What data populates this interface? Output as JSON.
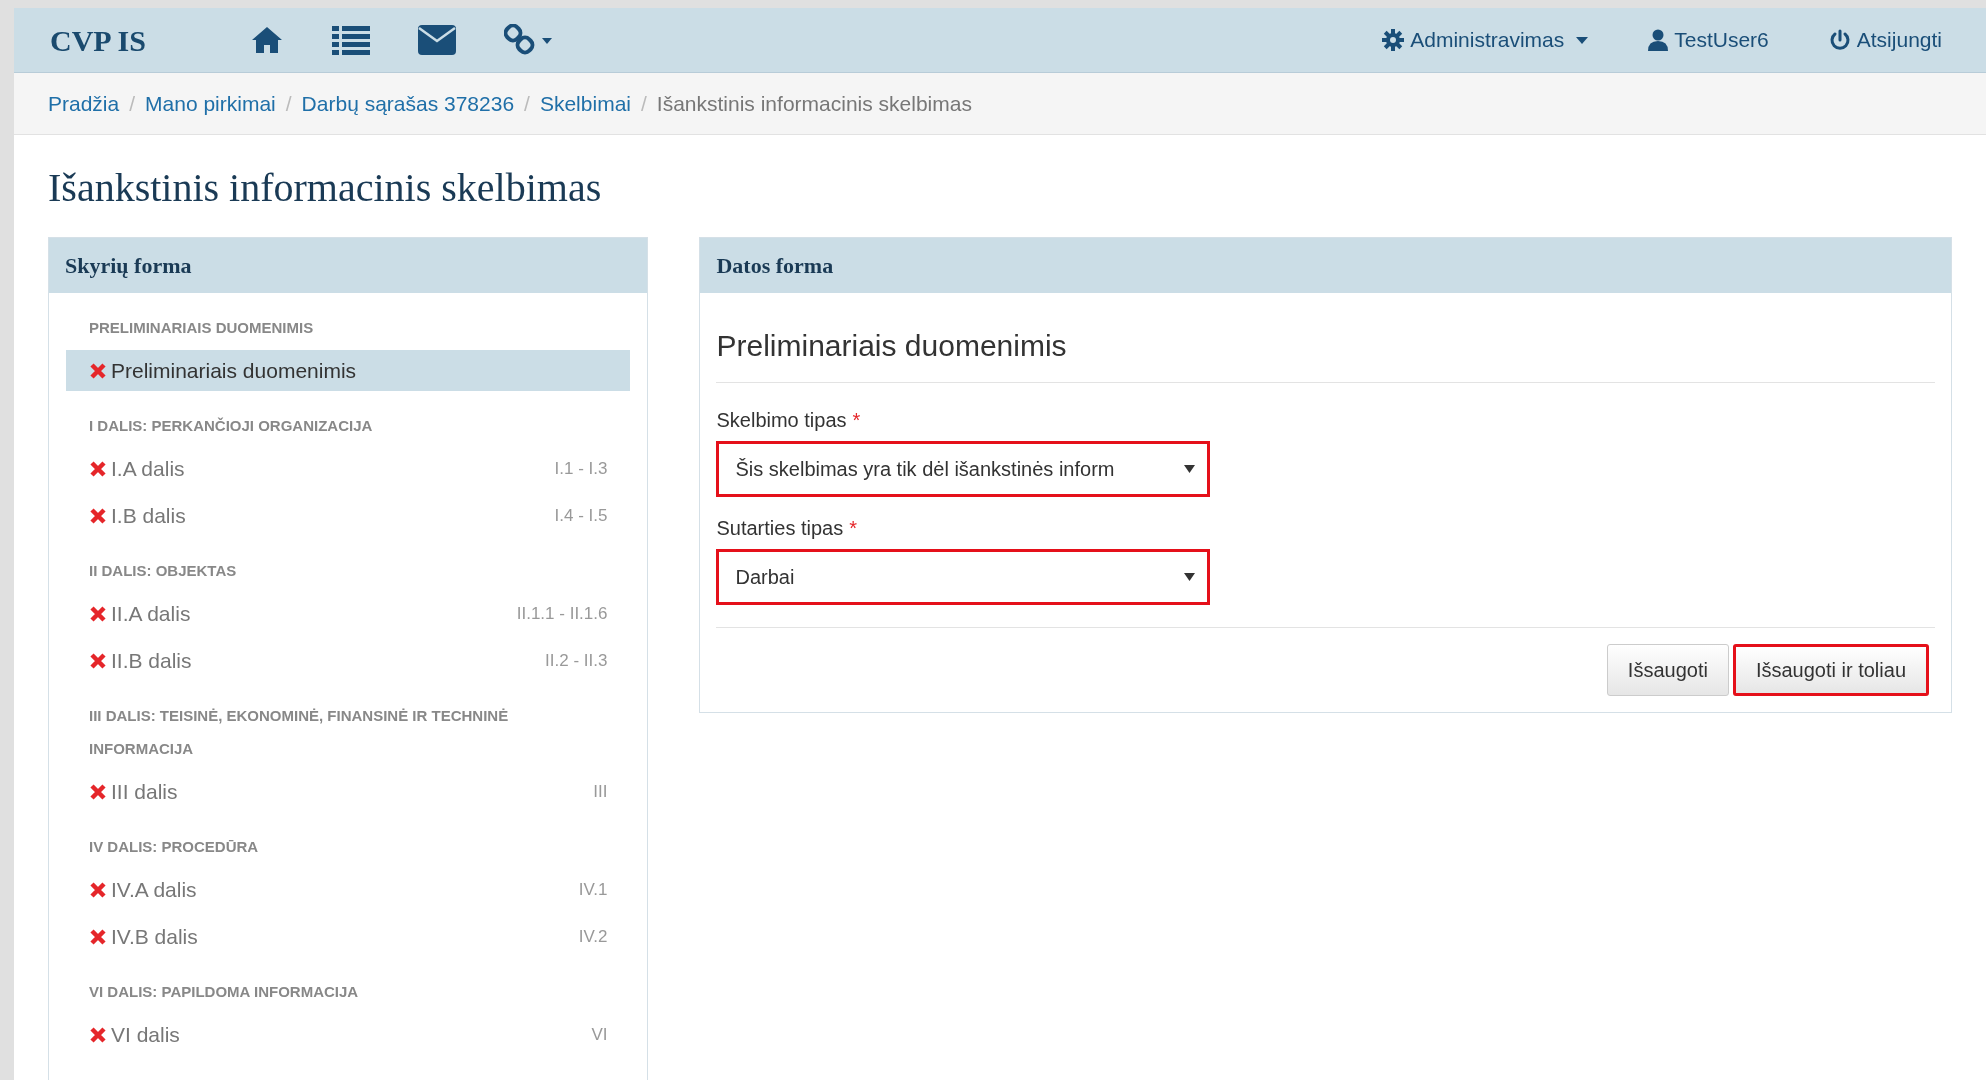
{
  "navbar": {
    "brand": "CVP IS",
    "icons": [
      {
        "kind": "home"
      },
      {
        "kind": "list"
      },
      {
        "kind": "mail"
      },
      {
        "kind": "link"
      }
    ],
    "right": [
      {
        "kind": "gear",
        "label": "Administravimas",
        "dropdown": true
      },
      {
        "kind": "user",
        "label": "TestUser6",
        "dropdown": false
      },
      {
        "kind": "power",
        "label": "Atsijungti",
        "dropdown": false
      }
    ]
  },
  "breadcrumb": [
    {
      "label": "Pradžia",
      "current": false
    },
    {
      "separator": "/",
      "label": "Mano pirkimai",
      "current": false
    },
    {
      "separator": "/",
      "label": "Darbų sąrašas 378236",
      "current": false
    },
    {
      "separator": "/",
      "label": "Skelbimai",
      "current": false
    },
    {
      "separator": "/",
      "label": "Išankstinis informacinis skelbimas",
      "current": true
    }
  ],
  "page_title": "Išankstinis informacinis skelbimas",
  "sidebar": {
    "title": "Skyrių forma",
    "sections": [
      {
        "heading": "PRELIMINARIAIS DUOMENIMIS",
        "items": [
          {
            "label": "Preliminariais duomenimis",
            "complete": false,
            "selected": true
          }
        ]
      },
      {
        "heading": "I DALIS: PERKANČIOJI ORGANIZACIJA",
        "items": [
          {
            "label": "I.A dalis",
            "range": "I.1 - I.3",
            "complete": false,
            "selected": false
          },
          {
            "label": "I.B dalis",
            "range": "I.4 - I.5",
            "complete": false,
            "selected": false
          }
        ]
      },
      {
        "heading": "II DALIS: OBJEKTAS",
        "items": [
          {
            "label": "II.A dalis",
            "range": "II.1.1 - II.1.6",
            "complete": false,
            "selected": false
          },
          {
            "label": "II.B dalis",
            "range": "II.2 - II.3",
            "complete": false,
            "selected": false
          }
        ]
      },
      {
        "heading": "III DALIS: TEISINĖ, EKONOMINĖ, FINANSINĖ IR TECHNINĖ INFORMACIJA",
        "items": [
          {
            "label": "III dalis",
            "range": "III",
            "complete": false,
            "selected": false
          }
        ]
      },
      {
        "heading": "IV DALIS: PROCEDŪRA",
        "items": [
          {
            "label": "IV.A dalis",
            "range": "IV.1",
            "complete": false,
            "selected": false
          },
          {
            "label": "IV.B dalis",
            "range": "IV.2",
            "complete": false,
            "selected": false
          }
        ]
      },
      {
        "heading": "VI DALIS: PAPILDOMA INFORMACIJA",
        "items": [
          {
            "label": "VI dalis",
            "range": "VI",
            "complete": false,
            "selected": false
          }
        ]
      }
    ]
  },
  "form": {
    "title": "Datos forma",
    "section_title": "Preliminariais duomenimis",
    "fields": [
      {
        "label": "Skelbimo tipas",
        "required_mark": "*",
        "value": "Šis skelbimas yra tik dėl išankstinės inform",
        "highlighted": true
      },
      {
        "label": "Sutarties tipas",
        "required_mark": "*",
        "value": "Darbai",
        "highlighted": true
      }
    ],
    "buttons": [
      {
        "label": "Išsaugoti",
        "highlighted": false
      },
      {
        "label": "Išsaugoti ir toliau",
        "highlighted": true
      }
    ]
  }
}
